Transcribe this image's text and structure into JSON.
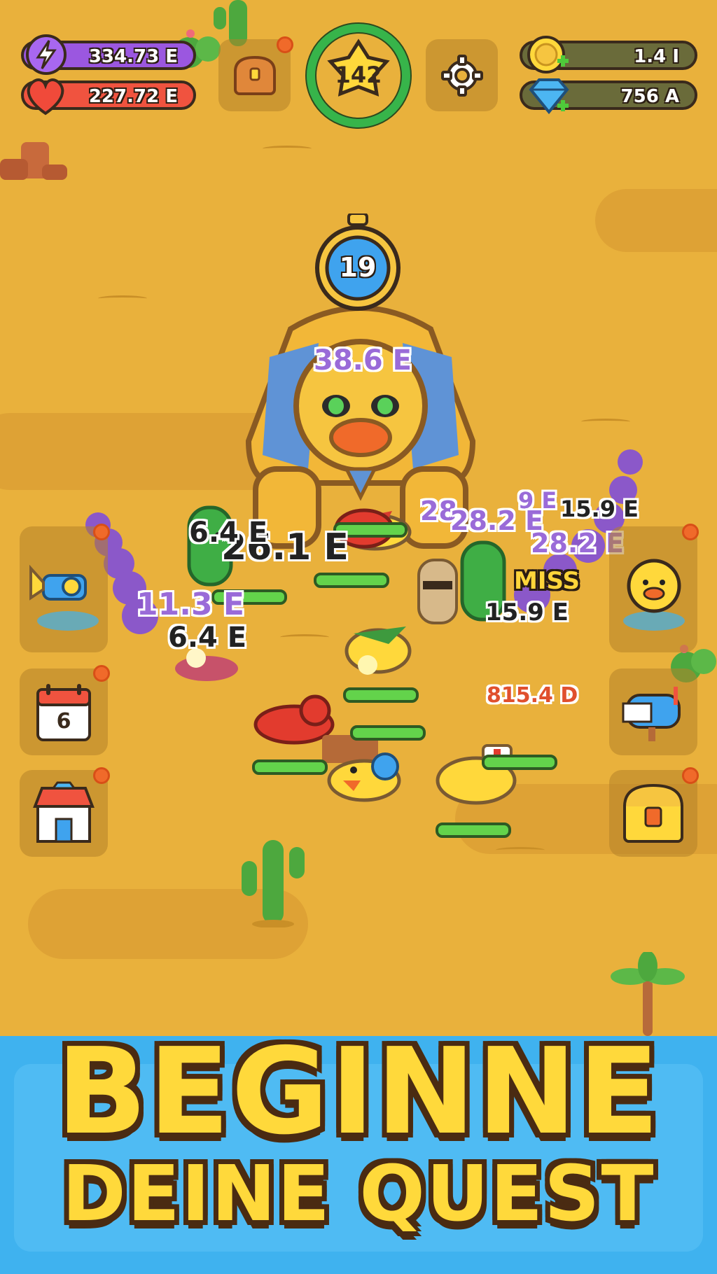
{
  "hud": {
    "energy": "334.73 E",
    "health": "227.72 E",
    "level": "142",
    "gold": "1.4 I",
    "gems": "756 A"
  },
  "boss": {
    "timer": "19"
  },
  "damage_numbers": {
    "boss_hit": "38.6 E",
    "big_hit": "26.1 E",
    "hit_left_1": "11.3 E",
    "hit_left_2": "6.4 E",
    "hit_left_3": "6.4 E",
    "hit_right_1": "28.2 E",
    "hit_right_2": "28.2 E",
    "hit_right_3": "15.9 E",
    "hit_right_4": "15.9 E",
    "hit_right_5": "28.",
    "hit_right_6": "9 E",
    "miss": "MISS",
    "enemy_damage": "815.4 D"
  },
  "side_buttons": {
    "calendar_day": "6"
  },
  "banner": {
    "line1": "BEGINNE",
    "line2": "DEINE QUEST"
  },
  "colors": {
    "sand": "#e9b13c",
    "energy_bar": "#9b57e0",
    "health_bar": "#f0533f",
    "level_ring": "#37b44a",
    "banner_blue": "#3fb2ef",
    "banner_yellow": "#ffd93b"
  }
}
